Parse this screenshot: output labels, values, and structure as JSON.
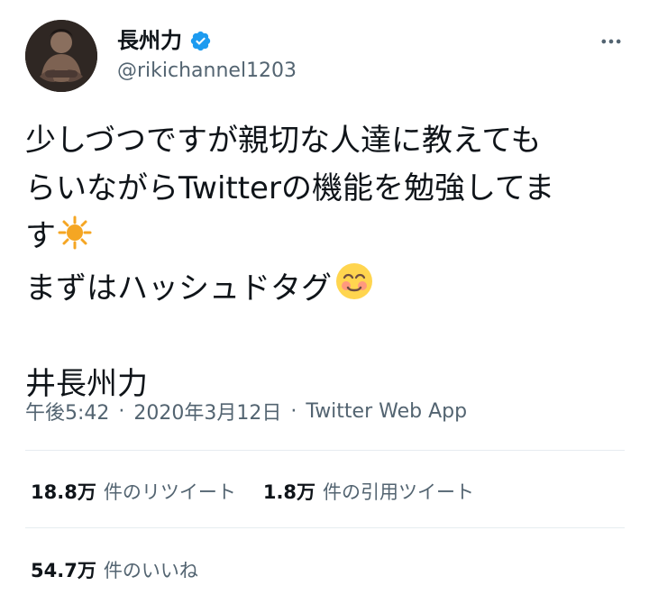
{
  "user": {
    "display_name": "長州力",
    "handle": "@rikichannel1203",
    "verified": true
  },
  "tweet": {
    "line1": "少しづつですが親切な人達に教えても",
    "line2": "らいながらTwitterの機能を勉強してま",
    "line3": "す",
    "line4": "まずはハッシュドタグ",
    "line5": "",
    "line6": "井長州力"
  },
  "meta": {
    "time": "午後5:42",
    "separator1": "·",
    "date": "2020年3月12日",
    "separator2": "·",
    "source": "Twitter Web App"
  },
  "stats": {
    "retweets_count": "18.8万",
    "retweets_label": "件のリツイート",
    "quotes_count": "1.8万",
    "quotes_label": "件の引用ツイート",
    "likes_count": "54.7万",
    "likes_label": "件のいいね"
  },
  "icons": {
    "verified": "verified-badge-icon",
    "more": "more-options-icon",
    "sun": "sun-emoji-icon",
    "smiling": "smiling-face-icon"
  },
  "colors": {
    "verified_blue": "#1d9bf0",
    "muted_text": "#536471",
    "text": "#0f1419",
    "divider": "#e6ecf0"
  }
}
